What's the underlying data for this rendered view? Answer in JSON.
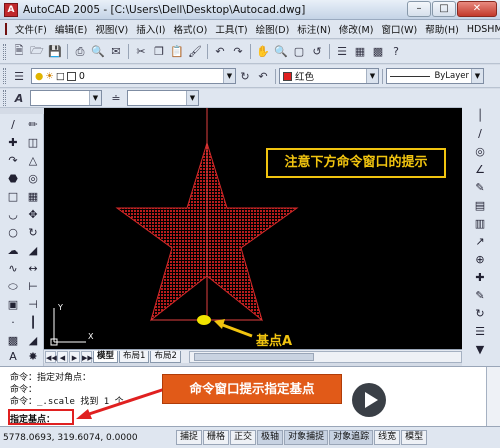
{
  "window": {
    "title": "AutoCAD 2005 - [C:\\Users\\Dell\\Desktop\\Autocad.dwg]",
    "app_icon": "A"
  },
  "menubar": {
    "items": [
      "文件(F)",
      "编辑(E)",
      "视图(V)",
      "插入(I)",
      "格式(O)",
      "工具(T)",
      "绘图(D)",
      "标注(N)",
      "修改(M)",
      "窗口(W)",
      "帮助(H)",
      "HDSHM"
    ]
  },
  "layers_toolbar": {
    "layer_value": "0",
    "color_value": "红色",
    "linetype_value": "ByLayer",
    "color_swatch": "#e02020"
  },
  "drawing": {
    "background": "#000000",
    "star_color": "#b81c1c",
    "callout_text": "注意下方命令窗口的提示",
    "point_label": "基点A",
    "highlight_color": "#f1c40f"
  },
  "layout_tabs": {
    "tabs": [
      "模型",
      "布局1",
      "布局2"
    ]
  },
  "command": {
    "lines": [
      "命令：指定对角点：",
      "命令：",
      "命令：_.scale 找到 1 个"
    ],
    "prompt": "指定基点：",
    "callout_text": "命令窗口提示指定基点"
  },
  "watermark": {
    "name": "溜溜自学",
    "url": "ZIXUE.3D66.COM"
  },
  "statusbar": {
    "coords": "5778.0693, 319.6074, 0.0000",
    "buttons": [
      "捕捉",
      "栅格",
      "正交",
      "极轴",
      "对象捕捉",
      "对象追踪",
      "线宽",
      "模型"
    ]
  }
}
